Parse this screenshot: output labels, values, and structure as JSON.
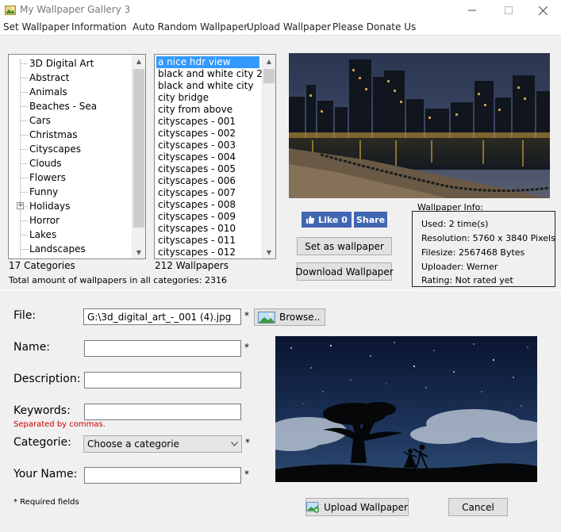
{
  "window": {
    "title": "My Wallpaper Gallery 3"
  },
  "menu": [
    "Set Wallpaper",
    "Information",
    "Auto Random Wallpaper",
    "Upload Wallpaper",
    "Please Donate Us"
  ],
  "categories": {
    "items": [
      "3D Digital Art",
      "Abstract",
      "Animals",
      "Beaches - Sea",
      "Cars",
      "Christmas",
      "Cityscapes",
      "Clouds",
      "Flowers",
      "Funny",
      "Holidays",
      "Horror",
      "Lakes",
      "Landscapes"
    ],
    "count_label": "17 Categories",
    "total_label": "Total amount of wallpapers in all categories: 2316"
  },
  "wallpapers": {
    "items": [
      "a nice hdr view",
      "black and white city 2",
      "black and white city",
      "city bridge",
      "city from above",
      "cityscapes - 001",
      "cityscapes - 002",
      "cityscapes - 003",
      "cityscapes - 004",
      "cityscapes - 005",
      "cityscapes - 006",
      "cityscapes - 007",
      "cityscapes - 008",
      "cityscapes - 009",
      "cityscapes - 010",
      "cityscapes - 011",
      "cityscapes - 012"
    ],
    "selected_index": 0,
    "count_label": "212 Wallpapers"
  },
  "social": {
    "like_label": "Like 0",
    "share_label": "Share"
  },
  "actions": {
    "set_wallpaper": "Set as wallpaper",
    "download_wallpaper": "Download Wallpaper"
  },
  "info": {
    "title": "Wallpaper Info:",
    "used": "Used: 2 time(s)",
    "resolution": "Resolution: 5760 x 3840 Pixels",
    "filesize": "Filesize: 2567468 Bytes",
    "uploader": "Uploader: Werner",
    "rating": "Rating: Not rated yet"
  },
  "form": {
    "file_label": "File:",
    "file_value": "G:\\3d_digital_art_-_001 (4).jpg",
    "browse_label": "Browse..",
    "name_label": "Name:",
    "name_value": "",
    "description_label": "Description:",
    "description_value": "",
    "keywords_label": "Keywords:",
    "keywords_value": "",
    "keywords_hint": "Separated by commas.",
    "category_label": "Categorie:",
    "category_value": "Choose a categorie",
    "yourname_label": "Your Name:",
    "yourname_value": "",
    "required_marker": "*",
    "required_note": "* Required fields",
    "upload_label": "Upload Wallpaper",
    "cancel_label": "Cancel"
  },
  "colors": {
    "selection": "#3399ff",
    "facebook": "#4267b2",
    "hint_red": "#cc0000"
  }
}
